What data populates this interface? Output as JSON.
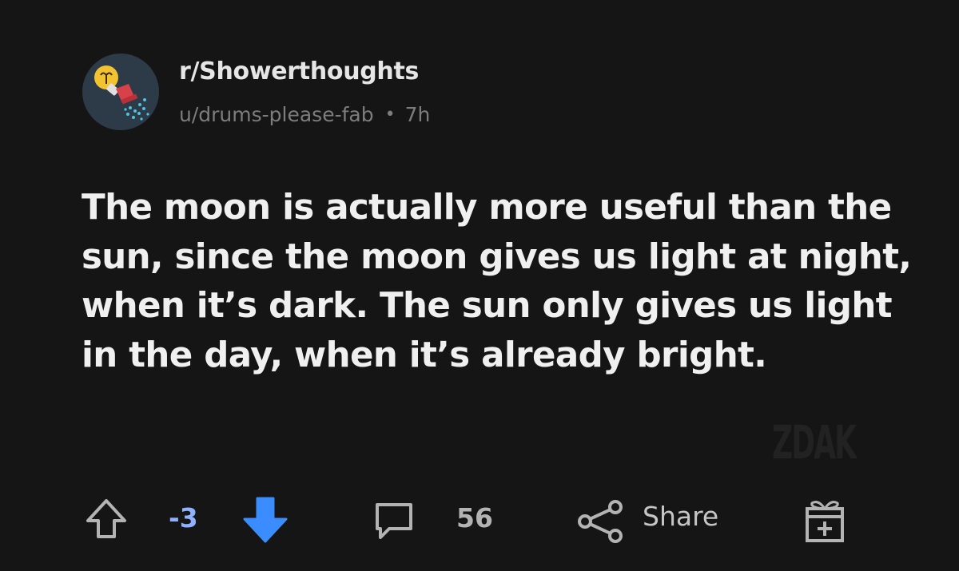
{
  "post": {
    "subreddit": "r/Showerthoughts",
    "author": "u/drums-please-fab",
    "separator": "•",
    "age": "7h",
    "title": "The moon is actually more useful than the sun, since the moon gives us light at night, when it’s dark. The sun only gives us light in the day, when it’s already bright.",
    "watermark": "ZDAK"
  },
  "actions": {
    "upvote_icon": "upvote-arrow-icon",
    "score": "-3",
    "downvote_icon": "downvote-arrow-icon",
    "comment_icon": "comment-bubble-icon",
    "comment_count": "56",
    "share_icon": "share-nodes-icon",
    "share_label": "Share",
    "gift_icon": "award-gift-icon"
  },
  "colors": {
    "background": "#151515",
    "text_primary": "#f0f0f0",
    "text_meta": "#7d7d7d",
    "score_color": "#8fb0ff",
    "downvote_active": "#3b8cff",
    "avatar_bg": "#2c3b47"
  }
}
